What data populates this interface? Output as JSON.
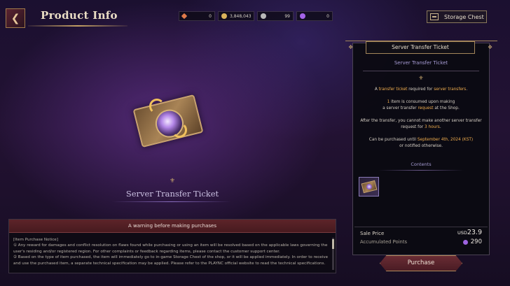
{
  "header": {
    "title": "Product Info",
    "back_icon": "back-arrow-icon"
  },
  "currencies": [
    {
      "name": "arrow-currency",
      "value": "0",
      "color": "#e07a4a"
    },
    {
      "name": "gold-coin",
      "value": "3,848,043",
      "color": "#d9b25a"
    },
    {
      "name": "silver-coin",
      "value": "99",
      "color": "#b8b8b8"
    },
    {
      "name": "purple-gem",
      "value": "0",
      "color": "#a463e8"
    }
  ],
  "storage_button": {
    "label": "Storage Chest",
    "icon": "storage-chest-icon"
  },
  "item": {
    "name": "Server Transfer Ticket"
  },
  "warning": {
    "title": "A warning before making purchases",
    "lines": [
      "[Item Purchase Notice]",
      "① Any reward for damages and conflict resolution on flaws found while purchasing or using an item will be resolved based on the applicable laws governing the",
      "user's residing and/or registered region. For other complaints or feedback regarding items, please contact the customer support center.",
      "② Based on the type of item purchased, the item will immediately go to in-game Storage Chest of the shop, or it will be applied immediately. In order to receive",
      "and use the purchased item, a separate technical specification may be applied. Please refer to the PLAYNC official website to read the technical specifications."
    ]
  },
  "detail": {
    "header": "Server Transfer Ticket",
    "subtitle": "Server Transfer Ticket",
    "desc": {
      "p1_a": "A ",
      "p1_b": "transfer ticket",
      "p1_c": " required for ",
      "p1_d": "server transfers",
      "p1_e": ".",
      "p2_a": "1",
      "p2_b": " item is consumed upon making",
      "p2_c": "a server transfer ",
      "p2_d": "request",
      "p2_e": " at the Shop.",
      "p3_a": "After the transfer, you cannot make another server transfer",
      "p3_b": "request for ",
      "p3_c": "3 hours",
      "p3_d": ".",
      "p4_a": "Can be purchased until ",
      "p4_b": "September 4th, 2024 (KST)",
      "p4_c": "or notified otherwise."
    },
    "contents_label": "Contents",
    "sale_price_label": "Sale Price",
    "sale_price_currency": "USD",
    "sale_price_value": "23.9",
    "points_label": "Accumulated Points",
    "points_value": "290",
    "purchase_label": "Purchase"
  }
}
